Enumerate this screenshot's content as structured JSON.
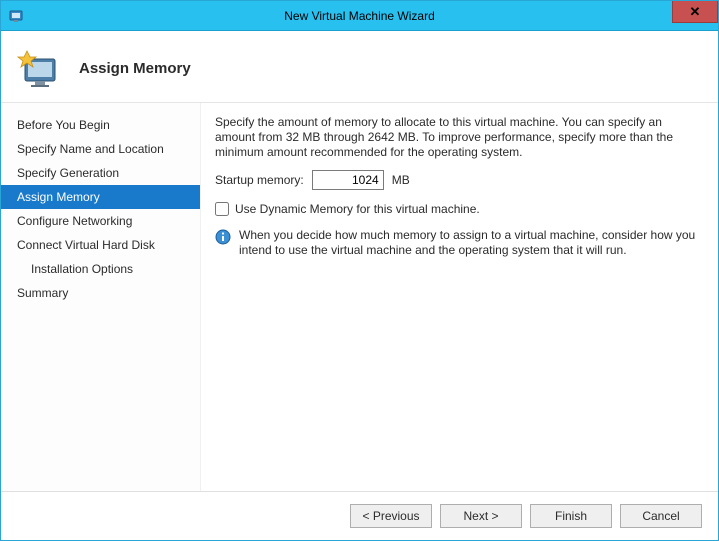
{
  "window": {
    "title": "New Virtual Machine Wizard",
    "close_glyph": "✕"
  },
  "header": {
    "page_title": "Assign Memory"
  },
  "sidebar": {
    "items": [
      {
        "label": "Before You Begin",
        "selected": false,
        "indent": false
      },
      {
        "label": "Specify Name and Location",
        "selected": false,
        "indent": false
      },
      {
        "label": "Specify Generation",
        "selected": false,
        "indent": false
      },
      {
        "label": "Assign Memory",
        "selected": true,
        "indent": false
      },
      {
        "label": "Configure Networking",
        "selected": false,
        "indent": false
      },
      {
        "label": "Connect Virtual Hard Disk",
        "selected": false,
        "indent": false
      },
      {
        "label": "Installation Options",
        "selected": false,
        "indent": true
      },
      {
        "label": "Summary",
        "selected": false,
        "indent": false
      }
    ]
  },
  "content": {
    "description": "Specify the amount of memory to allocate to this virtual machine. You can specify an amount from 32 MB through 2642 MB. To improve performance, specify more than the minimum amount recommended for the operating system.",
    "startup_label": "Startup memory:",
    "startup_value": "1024",
    "startup_unit": "MB",
    "dynamic_label": "Use Dynamic Memory for this virtual machine.",
    "dynamic_checked": false,
    "info_text": "When you decide how much memory to assign to a virtual machine, consider how you intend to use the virtual machine and the operating system that it will run."
  },
  "footer": {
    "previous": "< Previous",
    "next": "Next >",
    "finish": "Finish",
    "cancel": "Cancel"
  }
}
